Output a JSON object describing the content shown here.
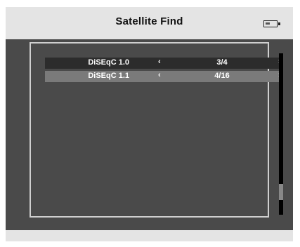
{
  "header": {
    "title": "Satellite Find",
    "battery_icon": "battery-icon",
    "battery_level": 0.45
  },
  "menu": {
    "rows": [
      {
        "label": "DiSEqC 1.0",
        "value": "3/4",
        "selected": false
      },
      {
        "label": "DiSEqC 1.1",
        "value": "4/16",
        "selected": true
      }
    ],
    "left_arrow": "‹",
    "right_arrow": "›"
  },
  "scrollbar": {
    "position": 0.9,
    "visible_fraction": 0.1
  },
  "colors": {
    "background": "#4a4a4a",
    "header": "#e4e4e4",
    "row_normal": "#2c2c2c",
    "row_selected": "#7a7a7a"
  }
}
